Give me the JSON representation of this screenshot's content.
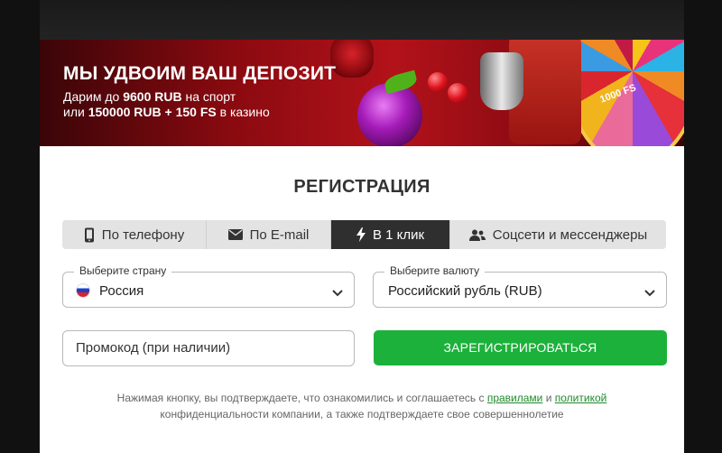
{
  "banner": {
    "title": "МЫ УДВОИМ ВАШ ДЕПОЗИТ",
    "line1_prefix": "Дарим до ",
    "line1_amount": "9600 RUB",
    "line1_suffix": " на спорт",
    "line2_prefix": "или ",
    "line2_amount": "150000 RUB + 150 FS",
    "line2_suffix": " в казино",
    "wheel_text": "1000 FS"
  },
  "registration": {
    "title": "РЕГИСТРАЦИЯ",
    "tabs": [
      {
        "label": "По телефону",
        "icon": "phone-icon",
        "active": false
      },
      {
        "label": "По E-mail",
        "icon": "envelope-icon",
        "active": false
      },
      {
        "label": "В 1 клик",
        "icon": "lightning-icon",
        "active": true
      },
      {
        "label": "Соцсети и мессенджеры",
        "icon": "users-icon",
        "active": false
      }
    ],
    "country": {
      "label": "Выберите страну",
      "value": "Россия"
    },
    "currency": {
      "label": "Выберите валюту",
      "value": "Российский рубль (RUB)"
    },
    "promo_placeholder": "Промокод (при наличии)",
    "submit_label": "ЗАРЕГИСТРИРОВАТЬСЯ",
    "terms": {
      "text1": "Нажимая кнопку, вы подтверждаете, что ознакомились и соглашаетесь с ",
      "link1": "правилами",
      "and": " и ",
      "link2": "политикой",
      "text2": "конфиденциальности компании, а также подтверждаете свое совершеннолетие"
    }
  },
  "colors": {
    "accent_green": "#1cb13a",
    "active_tab": "#2f2f2f",
    "link_green": "#1f8a2c"
  }
}
